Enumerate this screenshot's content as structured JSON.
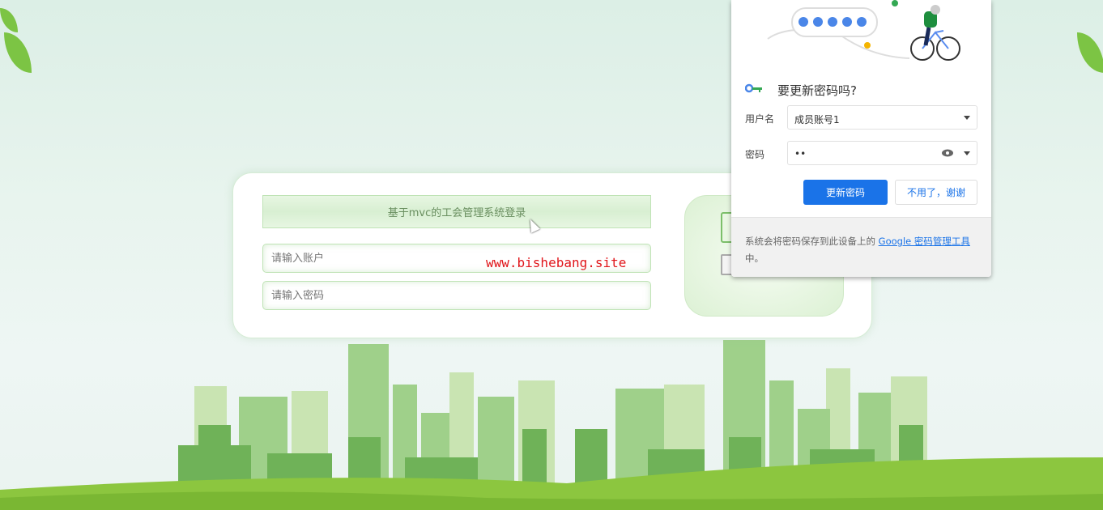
{
  "login": {
    "title": "基于mvc的工会管理系统登录",
    "account_placeholder": "请输入账户",
    "password_placeholder": "请输入密码"
  },
  "watermark": "www.bishebang.site",
  "password_popup": {
    "title": "要更新密码吗?",
    "username_label": "用户名",
    "username_value": "成员账号1",
    "password_label": "密码",
    "password_value": "••",
    "update_button": "更新密码",
    "decline_button": "不用了，谢谢",
    "footer_text": "系统会将密码保存到此设备上的 ",
    "footer_link": "Google 密码管理工具",
    "footer_suffix": "中。"
  },
  "colors": {
    "accent": "#1a73e8",
    "brand_green": "#7cbf6a",
    "watermark": "#e0161a"
  }
}
